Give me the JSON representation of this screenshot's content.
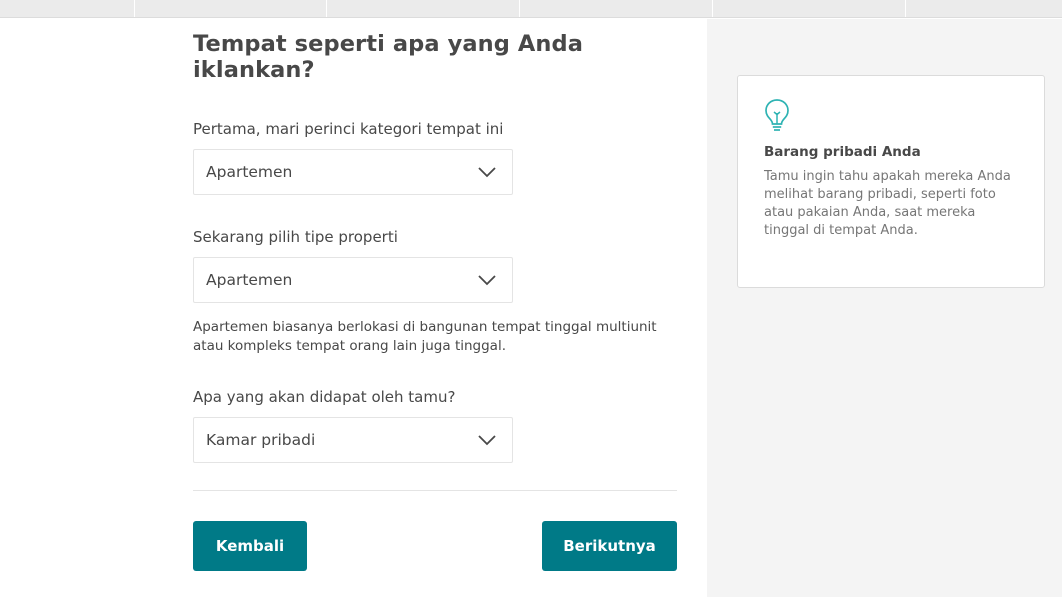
{
  "progress": {
    "segments": 6
  },
  "main": {
    "title": "Tempat seperti apa yang Anda iklankan?",
    "q1": {
      "label": "Pertama, mari perinci kategori tempat ini",
      "value": "Apartemen"
    },
    "q2": {
      "label": "Sekarang pilih tipe properti",
      "value": "Apartemen",
      "helper": "Apartemen biasanya berlokasi di bangunan tempat tinggal multiunit atau kompleks tempat orang lain juga tinggal."
    },
    "q3": {
      "label": "Apa yang akan didapat oleh tamu?",
      "value": "Kamar pribadi"
    },
    "back_label": "Kembali",
    "next_label": "Berikutnya"
  },
  "tip": {
    "icon": "lightbulb-icon",
    "title": "Barang pribadi Anda",
    "body": "Tamu ingin tahu apakah mereka Anda melihat barang pribadi, seperti foto atau pakaian Anda, saat mereka tinggal di tempat Anda."
  },
  "colors": {
    "accent": "#007a87",
    "tip_icon": "#2eb3b3",
    "panel_bg": "#f4f4f4"
  }
}
